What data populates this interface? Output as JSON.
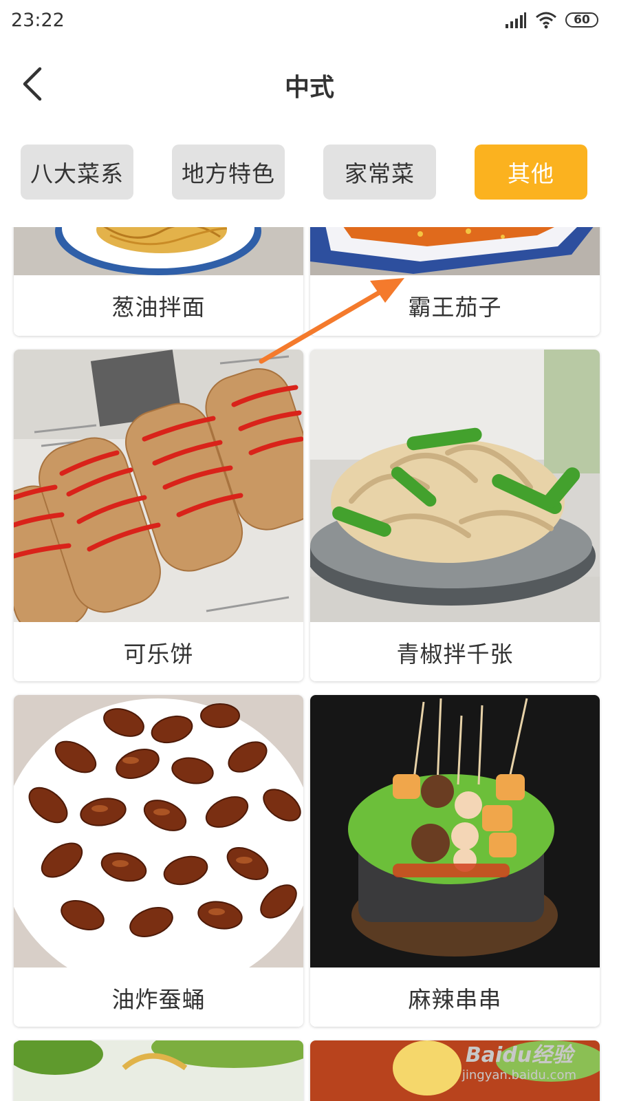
{
  "status": {
    "time": "23:22",
    "battery": "60",
    "icons": [
      "signal-icon",
      "wifi-icon",
      "battery-icon"
    ]
  },
  "header": {
    "title": "中式",
    "back_icon": "chevron-left-icon"
  },
  "tabs": [
    {
      "label": "八大菜系",
      "active": false
    },
    {
      "label": "地方特色",
      "active": false
    },
    {
      "label": "家常菜",
      "active": false
    },
    {
      "label": "其他",
      "active": true
    }
  ],
  "colors": {
    "accent": "#fbb21f",
    "tab_inactive": "#e2e2e2",
    "annotation_arrow": "#f47a2c"
  },
  "dishes": [
    {
      "name": "葱油拌面"
    },
    {
      "name": "霸王茄子"
    },
    {
      "name": "可乐饼"
    },
    {
      "name": "青椒拌千张"
    },
    {
      "name": "油炸蚕蛹"
    },
    {
      "name": "麻辣串串"
    }
  ],
  "watermark": {
    "main": "Baidu经验",
    "sub": "jingyan.baidu.com"
  }
}
